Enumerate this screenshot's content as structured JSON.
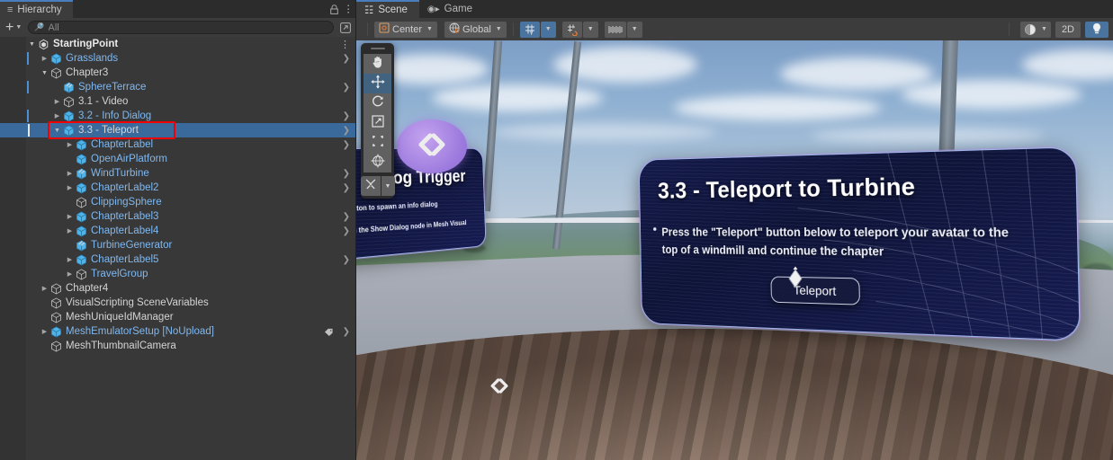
{
  "hierarchy": {
    "tab_label": "Hierarchy",
    "tab_icon": "hierarchy-icon",
    "lock_icon": "lock-icon",
    "menu_icon": "kebab-menu-icon",
    "add_label": "+",
    "search": {
      "placeholder": "All",
      "value": "",
      "icon": "search-icon"
    },
    "expand_icon": "open-in-new-icon",
    "tree": [
      {
        "label": "StartingPoint",
        "depth": 0,
        "icon": "unity-logo-icon",
        "color": "root",
        "twisty": "open",
        "chevron": false,
        "kebab": true,
        "mark": false
      },
      {
        "label": "Grasslands",
        "depth": 1,
        "icon": "prefab-cube-icon",
        "color": "prefab",
        "twisty": "closed",
        "chevron": true,
        "mark": true
      },
      {
        "label": "Chapter3",
        "depth": 1,
        "icon": "gameobject-cube-icon",
        "color": "white",
        "twisty": "open",
        "chevron": false,
        "mark": false
      },
      {
        "label": "SphereTerrace",
        "depth": 2,
        "icon": "prefab-variant-icon",
        "color": "prefab",
        "twisty": "none",
        "chevron": true,
        "mark": true
      },
      {
        "label": "3.1 - Video",
        "depth": 2,
        "icon": "gameobject-cube-icon",
        "color": "white",
        "twisty": "closed",
        "chevron": false,
        "mark": false
      },
      {
        "label": "3.2 - Info Dialog",
        "depth": 2,
        "icon": "prefab-cube-icon",
        "color": "prefab",
        "twisty": "closed",
        "chevron": true,
        "mark": true
      },
      {
        "label": "3.3 - Teleport",
        "depth": 2,
        "icon": "prefab-cube-icon",
        "color": "white",
        "twisty": "open",
        "chevron": true,
        "mark": true,
        "selected": true,
        "highlighted": true
      },
      {
        "label": "ChapterLabel",
        "depth": 3,
        "icon": "prefab-cube-icon",
        "color": "prefab",
        "twisty": "closed",
        "chevron": true,
        "mark": false
      },
      {
        "label": "OpenAirPlatform",
        "depth": 3,
        "icon": "prefab-cube-icon",
        "color": "prefab",
        "twisty": "none",
        "chevron": false,
        "mark": false
      },
      {
        "label": "WindTurbine",
        "depth": 3,
        "icon": "prefab-variant-icon",
        "color": "prefab",
        "twisty": "closed",
        "chevron": true,
        "mark": false
      },
      {
        "label": "ChapterLabel2",
        "depth": 3,
        "icon": "prefab-cube-icon",
        "color": "prefab",
        "twisty": "closed",
        "chevron": true,
        "mark": false
      },
      {
        "label": "ClippingSphere",
        "depth": 3,
        "icon": "gameobject-cube-icon",
        "color": "prefab",
        "twisty": "none",
        "chevron": false,
        "mark": false
      },
      {
        "label": "ChapterLabel3",
        "depth": 3,
        "icon": "prefab-cube-icon",
        "color": "prefab",
        "twisty": "closed",
        "chevron": true,
        "mark": false
      },
      {
        "label": "ChapterLabel4",
        "depth": 3,
        "icon": "prefab-cube-icon",
        "color": "prefab",
        "twisty": "closed",
        "chevron": true,
        "mark": false
      },
      {
        "label": "TurbineGenerator",
        "depth": 3,
        "icon": "prefab-variant-icon",
        "color": "prefab",
        "twisty": "none",
        "chevron": false,
        "mark": false
      },
      {
        "label": "ChapterLabel5",
        "depth": 3,
        "icon": "prefab-cube-icon",
        "color": "prefab",
        "twisty": "closed",
        "chevron": true,
        "mark": false
      },
      {
        "label": "TravelGroup",
        "depth": 3,
        "icon": "gameobject-cube-icon",
        "color": "prefab",
        "twisty": "closed",
        "chevron": false,
        "mark": false
      },
      {
        "label": "Chapter4",
        "depth": 1,
        "icon": "gameobject-cube-icon",
        "color": "white",
        "twisty": "closed",
        "chevron": false,
        "mark": false
      },
      {
        "label": "VisualScripting SceneVariables",
        "depth": 1,
        "icon": "gameobject-cube-icon",
        "color": "white",
        "twisty": "none",
        "chevron": false,
        "mark": false
      },
      {
        "label": "MeshUniqueIdManager",
        "depth": 1,
        "icon": "gameobject-cube-icon",
        "color": "white",
        "twisty": "none",
        "chevron": false,
        "mark": false
      },
      {
        "label": "MeshEmulatorSetup [NoUpload]",
        "depth": 1,
        "icon": "prefab-cube-icon",
        "color": "prefab",
        "twisty": "closed",
        "chevron": true,
        "tag": true,
        "mark": false
      },
      {
        "label": "MeshThumbnailCamera",
        "depth": 1,
        "icon": "gameobject-cube-icon",
        "color": "white",
        "twisty": "none",
        "chevron": false,
        "mark": false
      }
    ]
  },
  "scene": {
    "tabs": [
      {
        "label": "Scene",
        "icon": "grid-icon",
        "active": true
      },
      {
        "label": "Game",
        "icon": "gamepad-icon",
        "active": false
      }
    ],
    "toolbar": {
      "pivot_label": "Center",
      "pivot_icon": "pivot-center-icon",
      "space_label": "Global",
      "space_icon": "globe-icon",
      "grid_snap_icon": "grid-axis-y-icon",
      "grid_snap_active": true,
      "snap_increment_icon": "snap-magnet-icon",
      "ruler_icon": "ruler-icon",
      "shading_icon": "shading-sphere-icon",
      "view_2d_label": "2D",
      "lighting_icon": "lightbulb-icon",
      "lighting_active": true
    },
    "tools": [
      {
        "name": "hand-tool",
        "icon": "hand-icon",
        "active": false
      },
      {
        "name": "move-tool",
        "icon": "move-arrows-icon",
        "active": true
      },
      {
        "name": "rotate-tool",
        "icon": "rotate-icon",
        "active": false
      },
      {
        "name": "scale-tool",
        "icon": "scale-icon",
        "active": false
      },
      {
        "name": "rect-tool",
        "icon": "rect-transform-icon",
        "active": false
      },
      {
        "name": "transform-tool",
        "icon": "transform-globe-icon",
        "active": false
      },
      {
        "name": "custom-tool",
        "icon": "wrench-screwdriver-icon",
        "active": false
      }
    ],
    "panel_main": {
      "title": "3.3 - Teleport to Turbine",
      "body": "Press the \"Teleport\" button below to teleport your avatar to the top of a windmill and continue the chapter",
      "button_label": "Teleport"
    },
    "panel_left": {
      "title": "Dialog Trigger",
      "body_line1": "button to spawn an info dialog",
      "body_line2": "dialogs can be created using the Show Dialog  node in Mesh Visual Scripting"
    },
    "gizmos": [
      {
        "name": "visual-script-gizmo-large",
        "icon": "code-brackets-icon"
      },
      {
        "name": "visual-script-gizmo-small",
        "icon": "code-brackets-icon"
      },
      {
        "name": "teleport-gizmo",
        "icon": "diamond-icon"
      }
    ]
  },
  "annotation": {
    "highlight_color": "#f00000",
    "target": "3.3 - Teleport"
  }
}
